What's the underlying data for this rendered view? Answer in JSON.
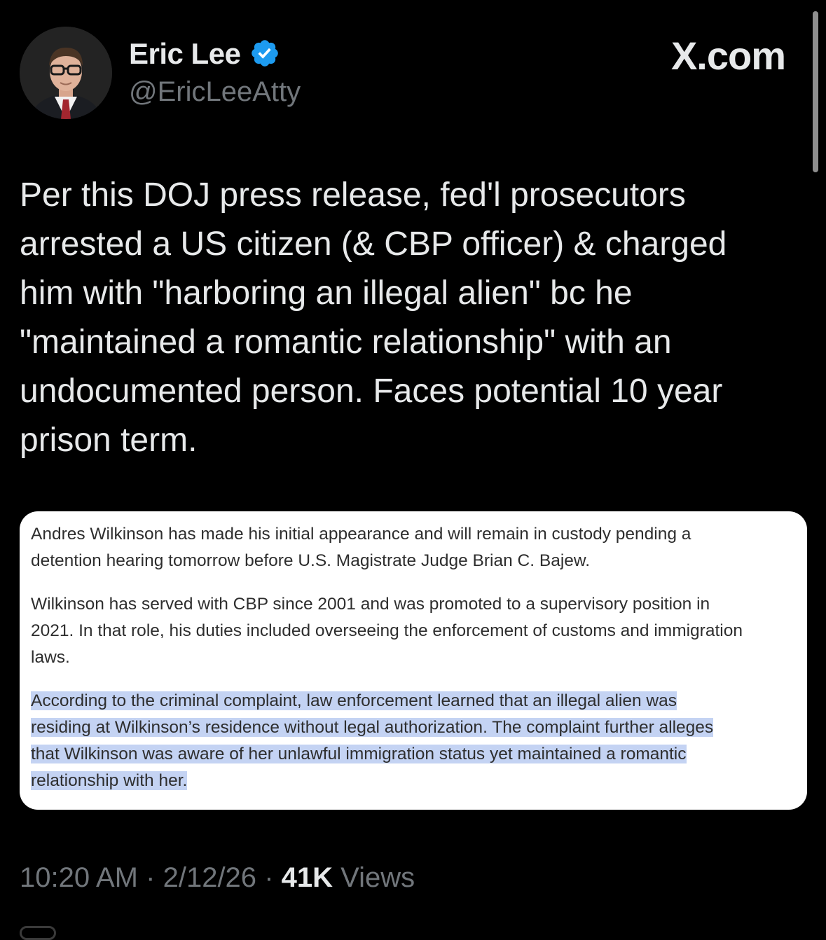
{
  "author": {
    "display_name": "Eric Lee",
    "handle": "@EricLeeAtty",
    "verified": true
  },
  "site_mark": "X.com",
  "tweet": {
    "text": "Per this DOJ press release, fed'l prosecutors\narrested a US citizen (& CBP officer) & charged\nhim with \"harboring an illegal alien\" bc he\n\"maintained a romantic relationship\" with an\nundocumented person. Faces potential 10 year\nprison term."
  },
  "quoted_release": {
    "paragraphs": [
      "Andres Wilkinson has made his initial appearance and will remain in custody pending a\ndetention hearing tomorrow before U.S. Magistrate Judge Brian C. Bajew.",
      "Wilkinson has served with CBP since 2001 and was promoted to a supervisory position in\n2021. In that role, his duties included overseeing the enforcement of customs and immigration\nlaws."
    ],
    "highlighted_lines": [
      "According to the criminal complaint, law enforcement learned that an illegal alien was",
      "residing at Wilkinson’s residence without legal authorization. The complaint further alleges",
      "that Wilkinson was aware of her unlawful immigration status yet maintained a romantic",
      "relationship with her."
    ]
  },
  "meta": {
    "time": "10:20 AM",
    "separator": "·",
    "date": "2/12/26",
    "views_count": "41K",
    "views_label": "Views"
  },
  "colors": {
    "background": "#000000",
    "primary_text": "#e7e9ea",
    "secondary_text": "#71767b",
    "verified_badge": "#1d9bf0",
    "highlight": "#c4d3f3"
  },
  "icons": {
    "verified": "verified-badge-icon",
    "avatar": "profile-photo"
  }
}
